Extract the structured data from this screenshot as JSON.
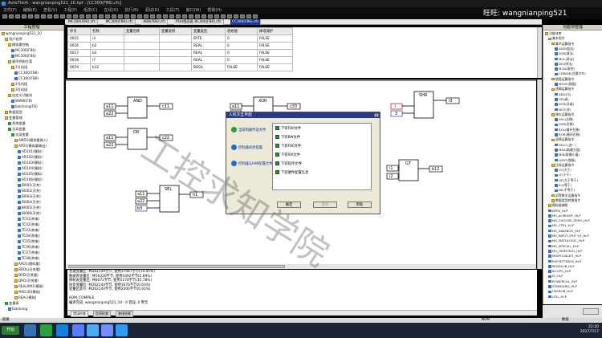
{
  "window": {
    "title": "AutoThink - wangnianping521_10.hpf - [CC300(FB6).cfc]"
  },
  "watermark": {
    "top_text": "旺旺: wangnianping521",
    "diagonal_text": "工控求知学院"
  },
  "menu": [
    "文件(F)",
    "编辑(E)",
    "查看(V)",
    "工程(P)",
    "组态(C)",
    "在线(O)",
    "执行(R)",
    "调试(D)",
    "工具(T)",
    "窗口(W)",
    "帮助(H)"
  ],
  "tabs": [
    "MC300(FB6).cfc",
    "MC300(FB6).cfc",
    "ABB(FB6).cfc",
    "POU组态器",
    "BC300(FB6).cfc",
    "CC300(FB6).cfc"
  ],
  "left_panel": {
    "header": "工程管理",
    "items": [
      "wangnianping521_10",
      "用户程序",
      "模拟量控制",
      "MC300(FB6)",
      "MC300(FB6)",
      "顺序控制方案",
      "1号机组",
      "CC300(FB6)",
      "CC300(FB6)",
      "2号机组",
      "3号机组",
      "自定义功能块",
      "WWW(FB)",
      "bianliang(FB)",
      "数据类型",
      "变量管理",
      "系统变量",
      "全局变量",
      "全局变量",
      "AMD1(模拟量输入)",
      "AP01(模拟量输出)",
      "AO101(模拟)",
      "AO102(模拟)",
      "AO103(模拟)",
      "AO104(模拟)",
      "AO105(模拟)",
      "AO106(模拟)",
      "BI001(开关)",
      "BI002(开关)",
      "BI003(开关)",
      "BI004(开关)",
      "BI005(开关)",
      "BI006(开关)",
      "TC01(热电)",
      "TC02(热电)",
      "TC03(热电)",
      "TC04(热电)",
      "TC05(热电)",
      "TC06(热电)",
      "TC07(热电)",
      "TC08(热电)",
      "APO1(模拟量)",
      "BOOL(开关量)",
      "DPD(开关量)",
      "DM1(开关量)",
      "REAL0M1(模拟)",
      "MISC30(模拟)",
      "REAL(模拟)",
      "变量表",
      "bianliang"
    ]
  },
  "var_table": {
    "headers": [
      "序号",
      "名称",
      "变量名称",
      "变量说明",
      "变量类型",
      "初始值",
      "掉电保护"
    ],
    "rows": [
      [
        "0015",
        "i3",
        "",
        "",
        "BYTE",
        "0",
        "FALSE"
      ],
      [
        "0016",
        "b2",
        "",
        "",
        "REAL",
        "0",
        "FALSE"
      ],
      [
        "0017",
        "b2",
        "",
        "",
        "REAL",
        "0",
        "FALSE"
      ],
      [
        "0018",
        "i7",
        "",
        "",
        "REAL",
        "0",
        "FALSE"
      ],
      [
        "0019",
        "b12",
        "",
        "",
        "BOOL",
        "FALSE",
        "FALSE"
      ]
    ]
  },
  "diagram": {
    "blocks": {
      "and_label": "AND",
      "or_label": "OR",
      "sel_label": "SEL",
      "xor_label": "XOR",
      "shr_label": "SHR",
      "gt_label": "GT"
    },
    "io": {
      "and_in1": "a11",
      "and_in2": "a22",
      "and_out": "c11",
      "or_in1": "a11",
      "or_in2": "a22",
      "or_out": "c22",
      "sel_in1": "a11",
      "sel_in2": "a22",
      "sel_in3": "b3",
      "sel_out": "h1",
      "xor_in1": "a11",
      "xor_in2": "a22",
      "xor_out": "c33",
      "shr_in1": "i",
      "shr_in2": "3",
      "shr_out": "i3",
      "gt_in1": "i1",
      "gt_in2": "i2",
      "gt_out": "b12"
    }
  },
  "dialog": {
    "title": "人机交互界面",
    "options": [
      "当前制器传送文件",
      "控制器同步配置",
      "控制器与HMI配置文件"
    ],
    "list": [
      "下装FB0文件",
      "下装BW文件",
      "下装FB0文件",
      "下装I00文件",
      "下装程序文件",
      "下装硬件配置信息"
    ],
    "buttons": {
      "ok": "确定",
      "cancel": "取消",
      "help": "帮助"
    }
  },
  "output": {
    "lines": [
      "普通变量区: 共262144字节, 使用37067字节(14.45%)",
      "数据库变量区: 共56320字节, 使用4392字节(2.89%)",
      "映射表变量区: 共8072字节, 使用1274字节(15.78%)",
      "同步变量区: 共262144字节, 使用1676字节(0.63%)",
      "变量区索引: 共262144字节, 使用2400字节(0.91%)",
      "",
      "AOM_COMPILE",
      "编译完成: wangnianping521_10 : 0 错误, 0 警告"
    ],
    "tabs": [
      "错误检查",
      "信息检查",
      "查找结果"
    ]
  },
  "right_panel": {
    "header": "功能块管理",
    "items": [
      "功能块库",
      "基本指令",
      "算术运算指令",
      "ADD(加法)",
      "SUB(减法)",
      "MUL(乘法)",
      "DIV(除法)",
      "MOD(取余)",
      "CHINGE(交换字节)",
      "赋值运算指令",
      "MOVE(赋值)",
      "逻辑运算指令",
      "AND(与)",
      "OR(或)",
      "XOR(异或)",
      "NOT(非)",
      "移位运算指令",
      "SHL(左移)",
      "SHR(右移)",
      "ROL(循环左移)",
      "ROR(循环右移)",
      "选择运算指令",
      "SEL(二选一)",
      "MAX(取最大值)",
      "MIN(取最小值)",
      "LIMIT(限幅)",
      "比较运算指令",
      "GT(大于)",
      "LT(小于)",
      "GE(大于等于)",
      "EQ(等于)",
      "NE(不等于)",
      "初等数学运算指令",
      "数据类型转换指令",
      "模拟量辅助",
      "DPFA_HLP",
      "MS_ALMLIMIT_HLP",
      "MS_CHOOSE_ZERO_HLP",
      "MS_CTRL_HLP",
      "MS_DIAGNOS_HLP",
      "MS_INPUT_IPUT V2_HLP",
      "MS_MATHLOGIC_HLP",
      "MS_SPECIAL_HLP",
      "MS_TIMEFIELD_HLP",
      "MISPECIALKIT_HLP",
      "RSPSETTINGS_HLP",
      "MODULIB_HLP",
      "IECCPC_HLP",
      "IO_HLP",
      "POWERCAL_HLP",
      "STANDARD_HLP",
      "USERLIB_HLP",
      "UTIL_HLP"
    ]
  },
  "status": {
    "left": "就绪",
    "mid": "NUM",
    "right": "数据"
  },
  "clock": {
    "time": "22:20",
    "date": "2017/7/17"
  }
}
